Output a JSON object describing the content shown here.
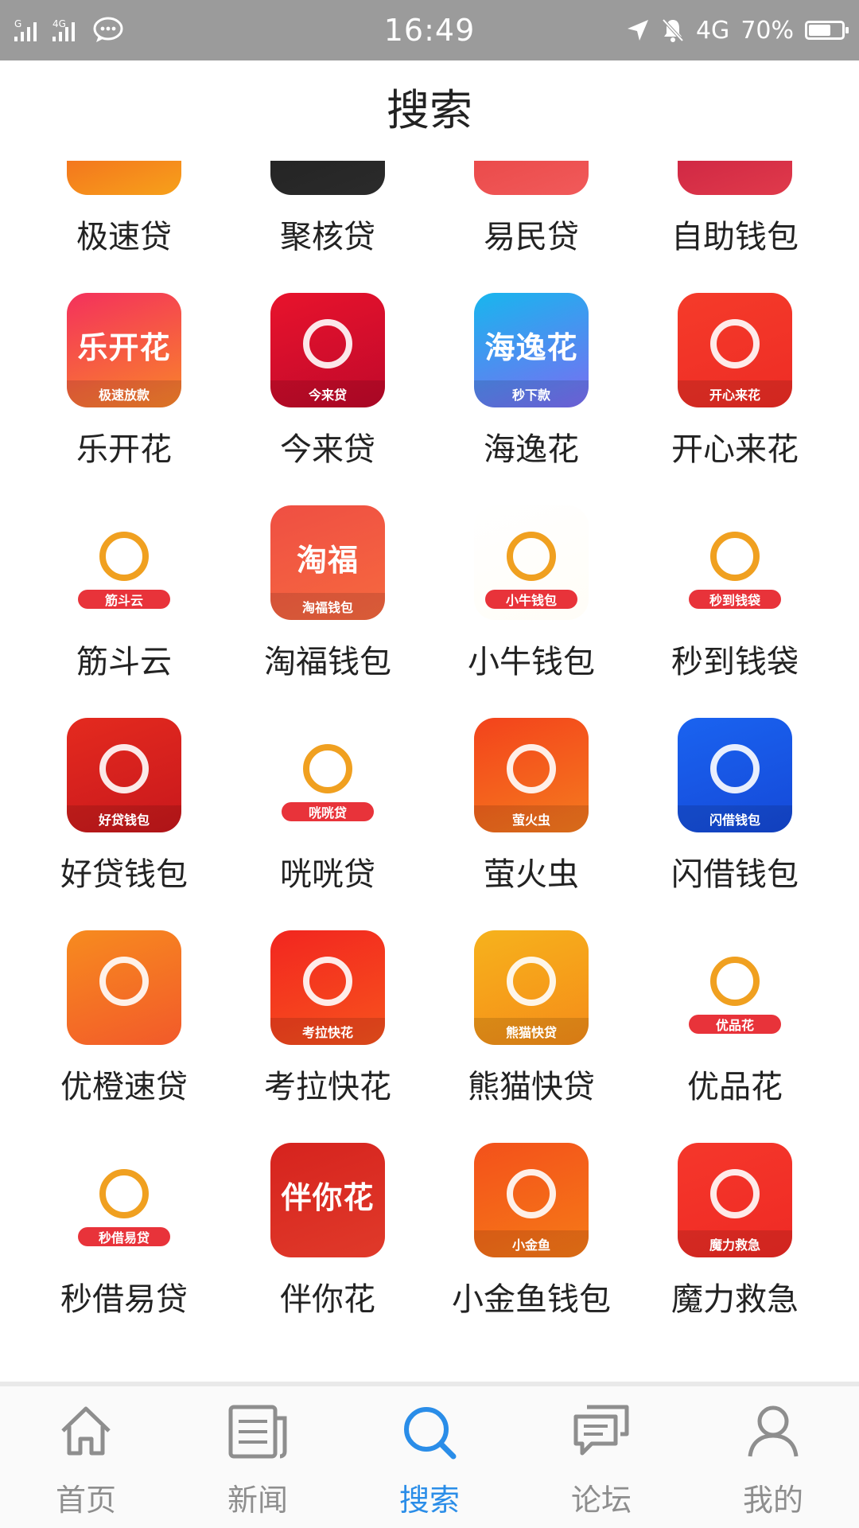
{
  "status_bar": {
    "left_signal_1": "G",
    "left_signal_2": "4G",
    "time": "16:49",
    "network": "4G",
    "battery": "70%",
    "battery_level": 0.7
  },
  "header": {
    "title": "搜索"
  },
  "apps": [
    {
      "label": "极速贷",
      "badge": "",
      "colors": [
        "#f04a22",
        "#f7a11a"
      ]
    },
    {
      "label": "聚核贷",
      "badge": "",
      "colors": [
        "#1d1d1d",
        "#2b2b2b"
      ]
    },
    {
      "label": "易民贷",
      "badge": "",
      "colors": [
        "#e43b3b",
        "#f15a5a"
      ]
    },
    {
      "label": "自助钱包",
      "badge": "",
      "colors": [
        "#c0163d",
        "#e03a4b"
      ]
    },
    {
      "label": "乐开花",
      "badge": "极速放款",
      "big": "乐开花",
      "colors": [
        "#f4315c",
        "#f9852a"
      ]
    },
    {
      "label": "今来贷",
      "badge": "今来贷",
      "colors": [
        "#e8132c",
        "#c0092b"
      ]
    },
    {
      "label": "海逸花",
      "badge": "秒下款",
      "big": "海逸花",
      "colors": [
        "#18b6ee",
        "#7b6cf2"
      ]
    },
    {
      "label": "开心来花",
      "badge": "开心来花",
      "colors": [
        "#f53b2a",
        "#ee2c25"
      ]
    },
    {
      "label": "筋斗云",
      "badge": "筋斗云",
      "colors": [
        "#ffffff",
        "#ffffff"
      ]
    },
    {
      "label": "淘福钱包",
      "badge": "淘福钱包",
      "big": "淘福",
      "colors": [
        "#ef4f43",
        "#f6693f"
      ]
    },
    {
      "label": "小牛钱包",
      "badge": "小牛钱包",
      "colors": [
        "#ffffff",
        "#fffdf7"
      ]
    },
    {
      "label": "秒到钱袋",
      "badge": "秒到钱袋",
      "colors": [
        "#ffffff",
        "#ffffff"
      ]
    },
    {
      "label": "好贷钱包",
      "badge": "好贷钱包",
      "colors": [
        "#e42a1f",
        "#c8181c"
      ]
    },
    {
      "label": "咣咣贷",
      "badge": "咣咣贷",
      "colors": [
        "#ffffff",
        "#ffffff"
      ]
    },
    {
      "label": "萤火虫",
      "badge": "萤火虫",
      "colors": [
        "#f3431c",
        "#f57b1e"
      ]
    },
    {
      "label": "闪借钱包",
      "badge": "闪借钱包",
      "colors": [
        "#1a63f0",
        "#1549d8"
      ]
    },
    {
      "label": "优橙速贷",
      "badge": "",
      "colors": [
        "#f78b1f",
        "#f25a2a"
      ]
    },
    {
      "label": "考拉快花",
      "badge": "考拉快花",
      "colors": [
        "#f2261f",
        "#f7531e"
      ]
    },
    {
      "label": "熊猫快贷",
      "badge": "熊猫快贷",
      "colors": [
        "#f6b21c",
        "#f58c19"
      ]
    },
    {
      "label": "优品花",
      "badge": "优品花",
      "colors": [
        "#ffffff",
        "#ffffff"
      ]
    },
    {
      "label": "秒借易贷",
      "badge": "秒借易贷",
      "colors": [
        "#ffffff",
        "#ffffff"
      ]
    },
    {
      "label": "伴你花",
      "badge": "",
      "big": "伴你花",
      "colors": [
        "#d6231e",
        "#e03a2a"
      ]
    },
    {
      "label": "小金鱼钱包",
      "badge": "小金鱼",
      "colors": [
        "#f3511b",
        "#f67a17"
      ]
    },
    {
      "label": "魔力救急",
      "badge": "魔力救急",
      "colors": [
        "#f5372b",
        "#ef2a24"
      ]
    }
  ],
  "bottom_nav": {
    "items": [
      {
        "label": "首页",
        "icon": "home-icon"
      },
      {
        "label": "新闻",
        "icon": "news-icon"
      },
      {
        "label": "搜索",
        "icon": "search-icon",
        "active": true
      },
      {
        "label": "论坛",
        "icon": "forum-icon"
      },
      {
        "label": "我的",
        "icon": "profile-icon"
      }
    ],
    "active_color": "#2a8de8",
    "inactive_color": "#8e8e8e"
  }
}
